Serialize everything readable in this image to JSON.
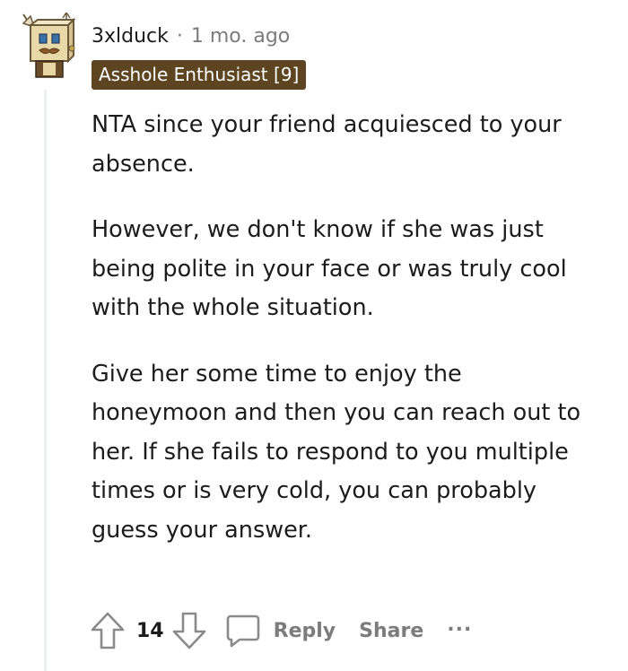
{
  "comment": {
    "username": "3xlduck",
    "separator": "·",
    "timestamp": "1 mo. ago",
    "flair": "Asshole Enthusiast [9]",
    "paragraphs": [
      "NTA since your friend acquiesced to your absence.",
      "However, we don't know if she was just being polite in your face or was truly cool with the whole situation.",
      "Give her some time to enjoy the honeymoon and then you can reach out to her. If she fails to respond to you multiple times or is very cold, you can probably guess your answer."
    ]
  },
  "actions": {
    "upvote_icon": "upvote-arrow-icon",
    "score": "14",
    "downvote_icon": "downvote-arrow-icon",
    "reply_icon": "speech-bubble-icon",
    "reply_label": "Reply",
    "share_label": "Share",
    "more_label": "..."
  },
  "colors": {
    "flair_background": "#5e4521",
    "flair_text": "#ffffff",
    "meta_text": "#7c7c7c",
    "body_text": "#1c1c1c",
    "thread_line": "#edeff1"
  }
}
